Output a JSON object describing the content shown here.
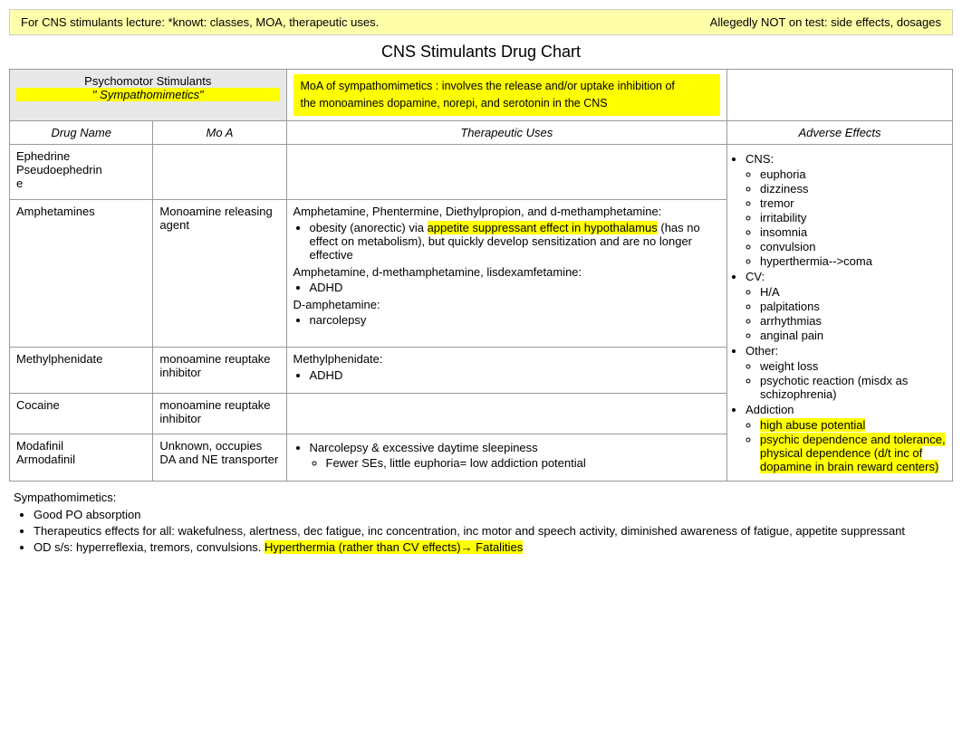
{
  "banner": {
    "left": "For CNS stimulants lecture: *knowt: classes, MOA, therapeutic uses.",
    "right": "Allegedly NOT on test: side effects, dosages"
  },
  "title": "CNS Stimulants Drug Chart",
  "moa_banner": {
    "line1": "MoA of sympathomimetics : involves the release and/or uptake inhibition of",
    "line2": "the monoamines dopamine, norepi, and serotonin in the CNS"
  },
  "section_header": {
    "col1": "Psychomotor Stimulants",
    "col2": "\" Sympathomimetics\""
  },
  "table_headers": {
    "drug_name": "Drug Name",
    "moa": "Mo A",
    "therapeutic": "Therapeutic Uses",
    "adverse": "Adverse Effects"
  },
  "adverse_effects": {
    "cns_header": "CNS:",
    "cns_items": [
      "euphoria",
      "dizziness",
      "tremor",
      "irritability",
      "insomnia",
      "convulsion",
      "hyperthermia-->coma"
    ],
    "cv_header": "CV:",
    "cv_items": [
      "H/A",
      "palpitations",
      "arrhythmias",
      "anginal pain"
    ],
    "other_header": "Other:",
    "other_items": [
      "weight loss",
      "psychotic reaction (misdx as schizophrenia)"
    ],
    "addiction_header": "Addiction",
    "addiction_items": {
      "item1": "high abuse potential",
      "item2": "psychic dependence and tolerance, physical dependence (d/t inc of dopamine in brain reward centers)"
    }
  },
  "rows": [
    {
      "drug": "Ephedrine\nPseudoephedrine",
      "moa": "",
      "therapeutic": ""
    },
    {
      "drug": "Amphetamines",
      "drug_suffix": "s",
      "moa": "Monoamine releasing agent",
      "therapeutic_parts": {
        "group1_intro": "Amphetamine, Phentermine, Diethylpropion, and d-methamphetamine:",
        "bullet1_pre": "obesity (anorectic) via",
        "bullet1_highlight": "appetite suppressant effect in hypothalamus",
        "bullet1_post": "(has no effect on metabolism), but quickly develop sensitization and are no longer effective",
        "group2_intro": "Amphetamine, d-methamphetamine, lisdexamfetamine:",
        "bullet2": "ADHD",
        "group3_intro": "D-amphetamine:",
        "bullet3": "narcolepsy"
      }
    },
    {
      "drug": "Methylphenidate",
      "moa": "monoamine reuptake inhibitor",
      "therapeutic_parts": {
        "intro": "Methylphenidate:",
        "bullet1": "ADHD"
      }
    },
    {
      "drug": "Cocaine",
      "moa": "monoamine reuptake inhibitor",
      "therapeutic": ""
    },
    {
      "drug": "Modafinil\nArmodafinil",
      "moa": "Unknown, occupies DA and NE transporter",
      "therapeutic_parts": {
        "bullet1": "Narcolepsy & excessive daytime sleepiness",
        "sub_bullet1": "Fewer SEs, little euphoria= low addiction potential"
      }
    }
  ],
  "bottom": {
    "header": "Sympathomimetics:",
    "bullet1": "Good PO absorption",
    "bullet2": "Therapeutics effects for all: wakefulness, alertness, dec fatigue, inc concentration, inc motor and speech activity, diminished awareness of fatigue, appetite suppressant",
    "bullet3_pre": "OD s/s: hyperreflexia, tremors, convulsions.",
    "bullet3_highlight": "Hyperthermia (rather than CV effects)→  Fatalities"
  }
}
